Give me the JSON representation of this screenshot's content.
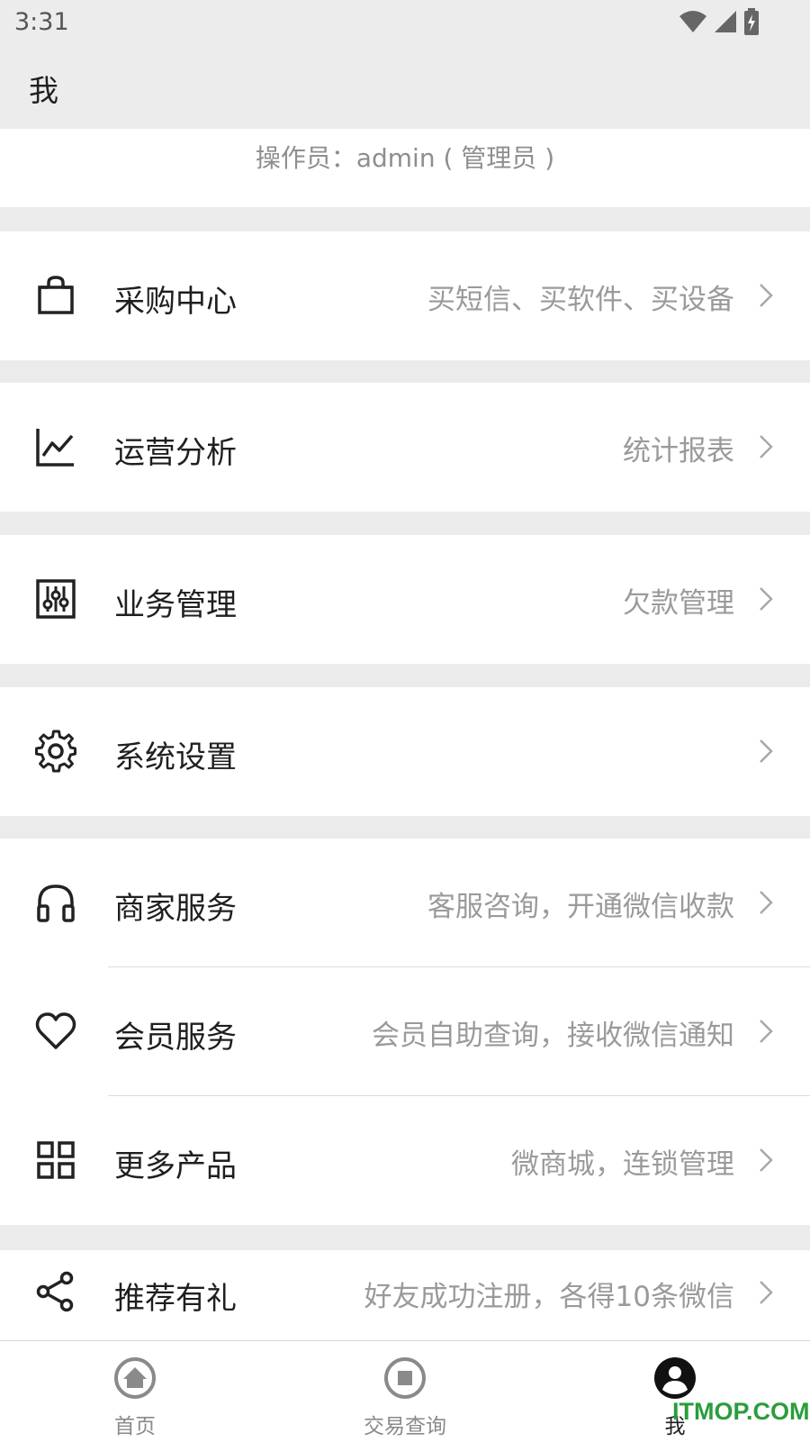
{
  "status_bar": {
    "time": "3:31",
    "icons": [
      "wifi-icon",
      "signal-icon",
      "battery-charging-icon"
    ]
  },
  "app_bar": {
    "title": "我"
  },
  "operator": {
    "text": "操作员：admin ( 管理员 )"
  },
  "menu_groups": [
    {
      "items": [
        {
          "icon": "shopping-bag-icon",
          "label": "采购中心",
          "value": "买短信、买软件、买设备"
        }
      ]
    },
    {
      "items": [
        {
          "icon": "line-chart-icon",
          "label": "运营分析",
          "value": "统计报表"
        }
      ]
    },
    {
      "items": [
        {
          "icon": "sliders-icon",
          "label": "业务管理",
          "value": "欠款管理"
        }
      ]
    },
    {
      "items": [
        {
          "icon": "gear-icon",
          "label": "系统设置",
          "value": ""
        }
      ]
    },
    {
      "items": [
        {
          "icon": "headphones-icon",
          "label": "商家服务",
          "value": "客服咨询，开通微信收款"
        },
        {
          "icon": "heart-icon",
          "label": "会员服务",
          "value": "会员自助查询，接收微信通知"
        },
        {
          "icon": "grid-icon",
          "label": "更多产品",
          "value": "微商城，连锁管理"
        }
      ]
    },
    {
      "items": [
        {
          "icon": "share-icon",
          "label": "推荐有礼",
          "value": "好友成功注册，各得10条微信"
        }
      ]
    }
  ],
  "tabs": [
    {
      "icon": "home-icon",
      "label": "首页",
      "active": false
    },
    {
      "icon": "transaction-icon",
      "label": "交易查询",
      "active": false
    },
    {
      "icon": "profile-icon",
      "label": "我",
      "active": true
    }
  ],
  "watermark": {
    "text": "ITMOP.COM"
  },
  "colors": {
    "background": "#ebebeb",
    "surface": "#ffffff",
    "primary_text": "#1f1f1f",
    "secondary_text": "#9a9a9a",
    "watermark": "#2a9d3c"
  }
}
